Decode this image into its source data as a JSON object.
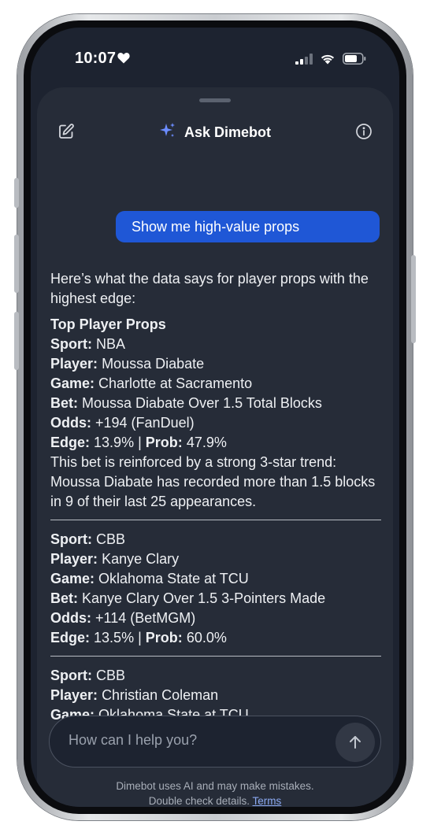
{
  "status": {
    "time": "10:07"
  },
  "header": {
    "title": "Ask Dimebot"
  },
  "user_message": "Show me high-value props",
  "assistant": {
    "intro": "Here’s what the data says for player props with the highest edge:",
    "heading": "Top Player Props",
    "props": [
      {
        "sport_label": "Sport:",
        "sport": "NBA",
        "player_label": "Player:",
        "player": "Moussa Diabate",
        "game_label": "Game:",
        "game": "Charlotte at Sacramento",
        "bet_label": "Bet:",
        "bet": "Moussa Diabate Over 1.5 Total Blocks",
        "odds_label": "Odds:",
        "odds": "+194 (FanDuel)",
        "edge_label": "Edge:",
        "edge": "13.9%",
        "separator": "|",
        "prob_label": "Prob:",
        "prob": "47.9%",
        "note": "This bet is reinforced by a strong 3-star trend: Moussa Diabate has recorded more than 1.5 blocks in 9 of their last 25 appearances."
      },
      {
        "sport_label": "Sport:",
        "sport": "CBB",
        "player_label": "Player:",
        "player": "Kanye Clary",
        "game_label": "Game:",
        "game": "Oklahoma State at TCU",
        "bet_label": "Bet:",
        "bet": "Kanye Clary Over 1.5 3-Pointers Made",
        "odds_label": "Odds:",
        "odds": "+114 (BetMGM)",
        "edge_label": "Edge:",
        "edge": "13.5%",
        "separator": "|",
        "prob_label": "Prob:",
        "prob": "60.0%"
      },
      {
        "sport_label": "Sport:",
        "sport": "CBB",
        "player_label": "Player:",
        "player": "Christian Coleman",
        "game_label": "Game:",
        "game": "Oklahoma State at TCU"
      }
    ]
  },
  "input": {
    "placeholder": "How can I help you?"
  },
  "disclaimer": {
    "line1": "Dimebot uses AI and may make mistakes.",
    "line2": "Double check details.",
    "terms": "Terms"
  },
  "colors": {
    "accent": "#1f57d6",
    "sparkle": "#6c8dff",
    "sheet_bg": "#262c38",
    "screen_bg": "#1d2330"
  },
  "icons": {
    "edit": "edit-icon",
    "sparkle": "sparkle-icon",
    "info": "info-icon",
    "send": "arrow-up-icon",
    "heart": "heart-icon",
    "signal": "signal-icon",
    "wifi": "wifi-icon",
    "battery": "battery-icon"
  }
}
